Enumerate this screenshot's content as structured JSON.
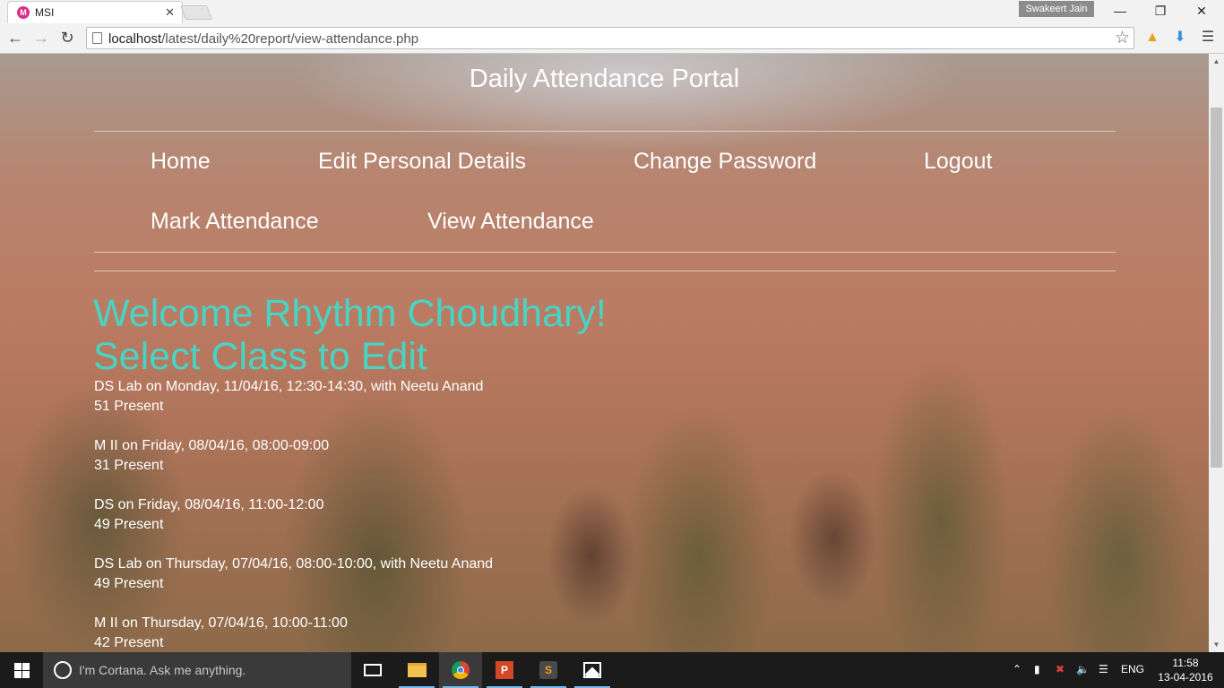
{
  "browser": {
    "tab_title": "MSI",
    "tab_favicon": "M",
    "profile_name": "Swakeert Jain",
    "url_host": "localhost",
    "url_path": "/latest/daily%20report/view-attendance.php"
  },
  "page": {
    "title": "Daily Attendance Portal",
    "nav": {
      "home": "Home",
      "edit_personal": "Edit Personal Details",
      "change_password": "Change Password",
      "logout": "Logout",
      "mark_attendance": "Mark Attendance",
      "view_attendance": "View Attendance"
    },
    "welcome": "Welcome Rhythm Choudhary!",
    "subheading": "Select Class to Edit",
    "classes": [
      {
        "desc": "DS Lab on Monday, 11/04/16, 12:30-14:30, with Neetu Anand",
        "present": "51 Present"
      },
      {
        "desc": "M II on Friday, 08/04/16, 08:00-09:00",
        "present": "31 Present"
      },
      {
        "desc": "DS on Friday, 08/04/16, 11:00-12:00",
        "present": "49 Present"
      },
      {
        "desc": "DS Lab on Thursday, 07/04/16, 08:00-10:00, with Neetu Anand",
        "present": "49 Present"
      },
      {
        "desc": "M II on Thursday, 07/04/16, 10:00-11:00",
        "present": "42 Present"
      }
    ],
    "accent_color": "#48d4c4"
  },
  "taskbar": {
    "search_placeholder": "I'm Cortana. Ask me anything.",
    "language": "ENG",
    "time": "11:58",
    "date": "13-04-2016"
  }
}
